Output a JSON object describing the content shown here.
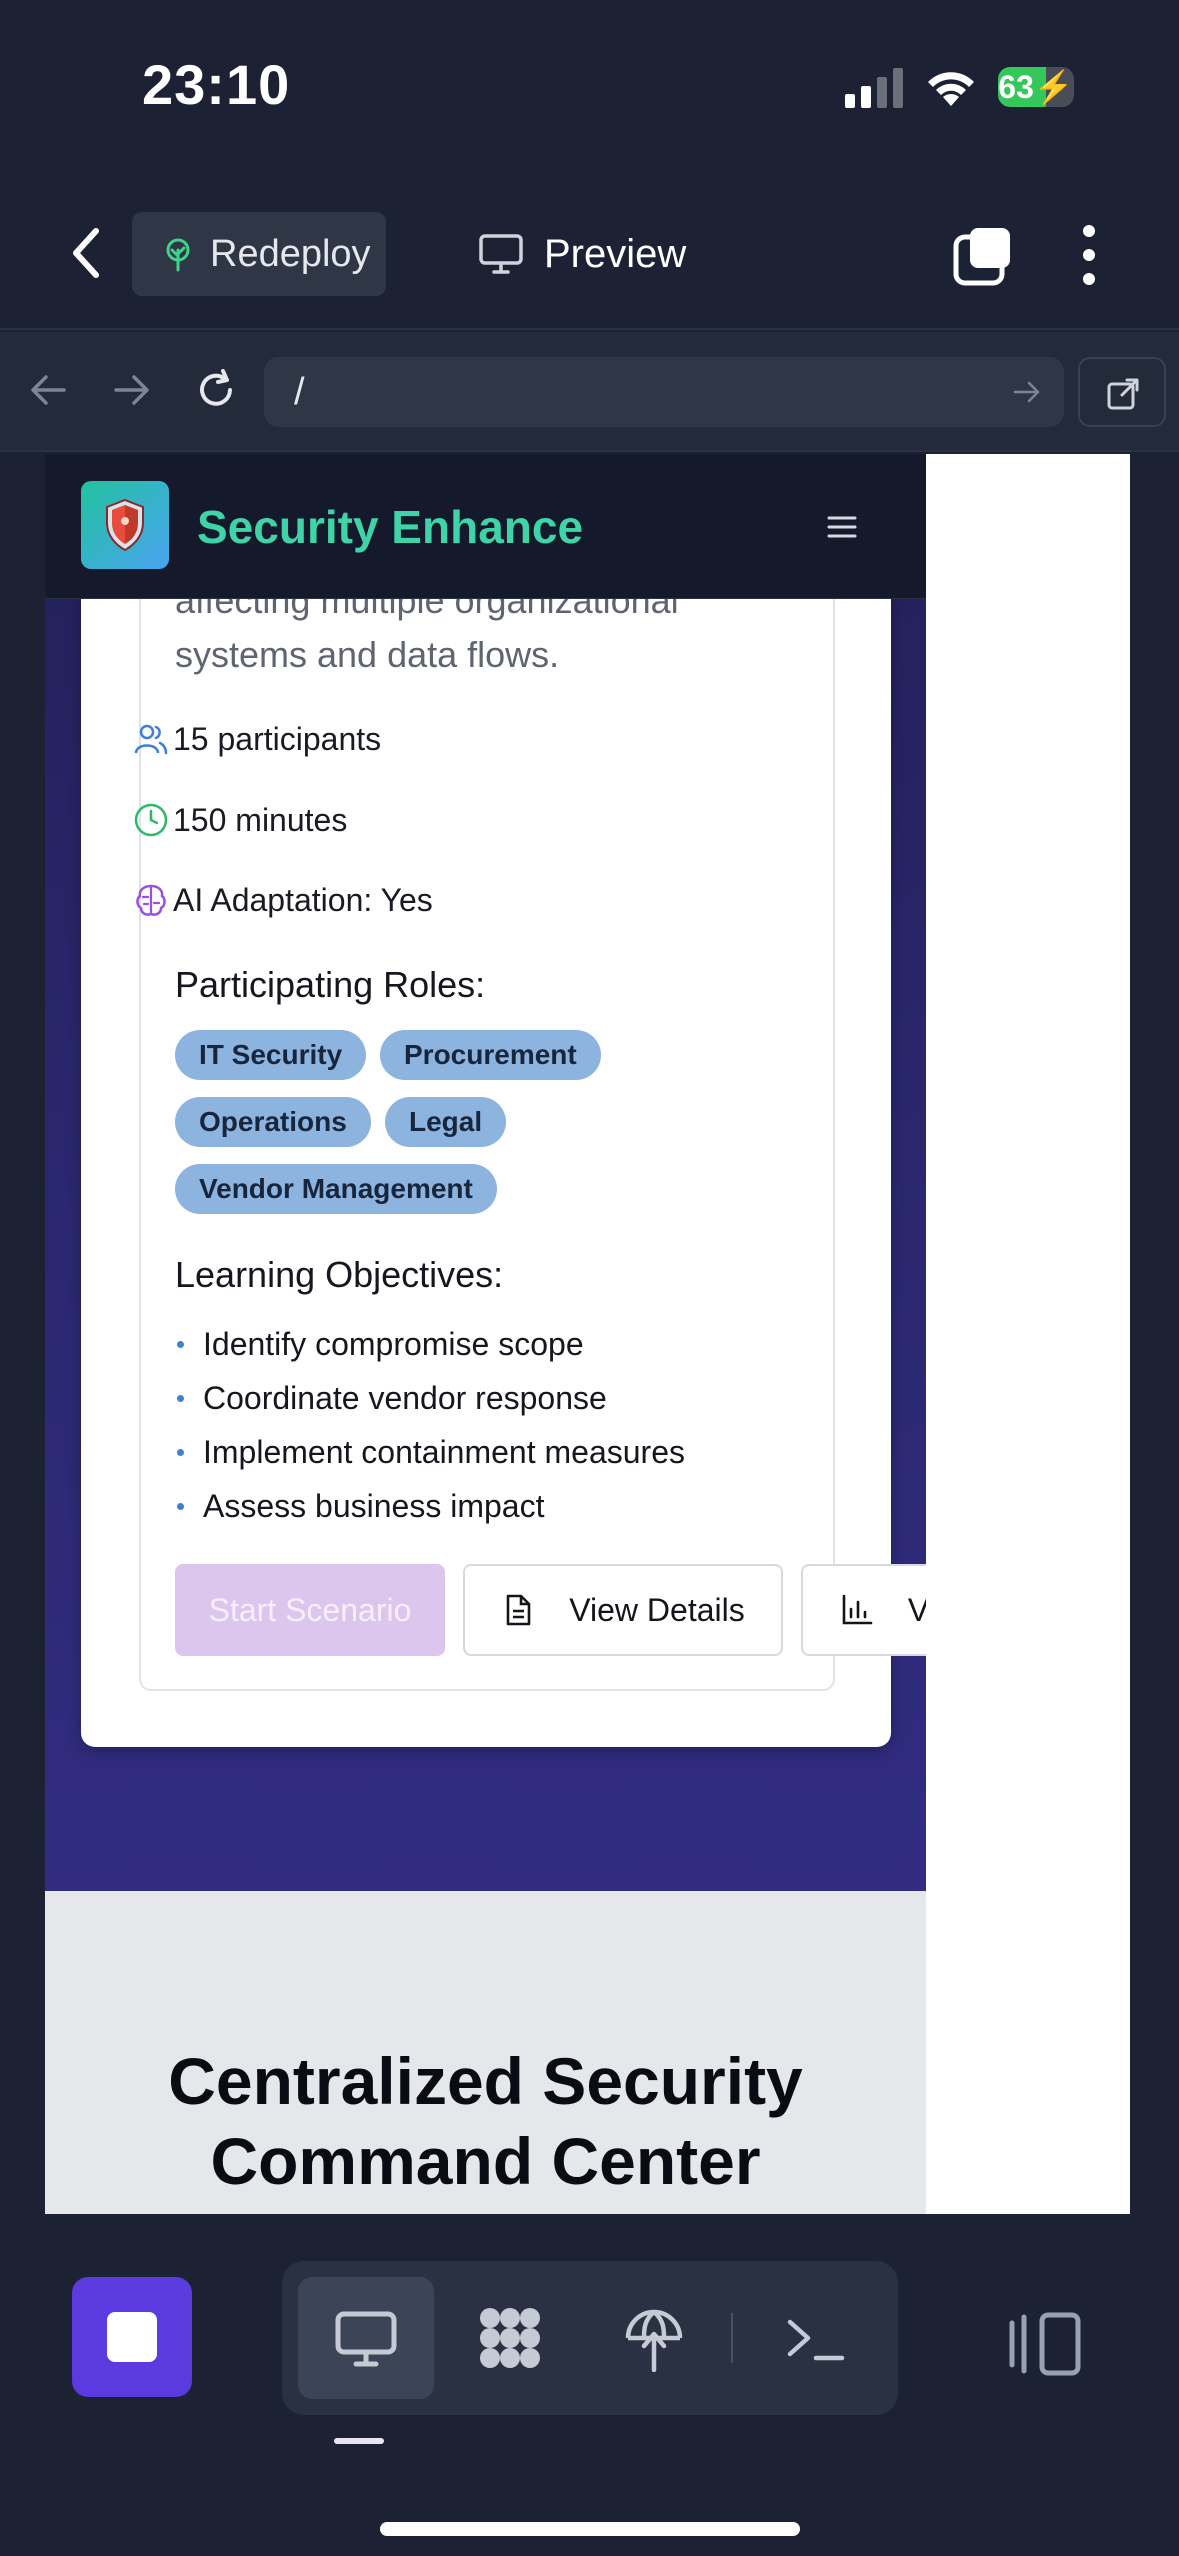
{
  "status_bar": {
    "time": "23:10",
    "battery_percent": 63,
    "battery_label": "63"
  },
  "app_header": {
    "redeploy_label": "Redeploy",
    "preview_label": "Preview"
  },
  "url_bar": {
    "url": "/"
  },
  "site": {
    "title": "Security Enhance",
    "scenario": {
      "description": "affecting multiple organizational systems and data flows.",
      "participants": "15 participants",
      "duration": "150 minutes",
      "ai_adaptation": "AI Adaptation: Yes",
      "roles_label": "Participating Roles:",
      "roles": [
        "IT Security",
        "Procurement",
        "Operations",
        "Legal",
        "Vendor Management"
      ],
      "objectives_label": "Learning Objectives:",
      "objectives": [
        "Identify compromise scope",
        "Coordinate vendor response",
        "Implement containment measures",
        "Assess business impact"
      ],
      "start_label": "Start Scenario",
      "details_label": "View Details",
      "results_label": "View Results"
    },
    "section_heading": "Centralized Security Command Center"
  },
  "colors": {
    "accent": "#5b3ae0",
    "brand": "#3fd3a7",
    "role_tag": "#8db3df",
    "start_disabled": "#dcc6ee"
  }
}
